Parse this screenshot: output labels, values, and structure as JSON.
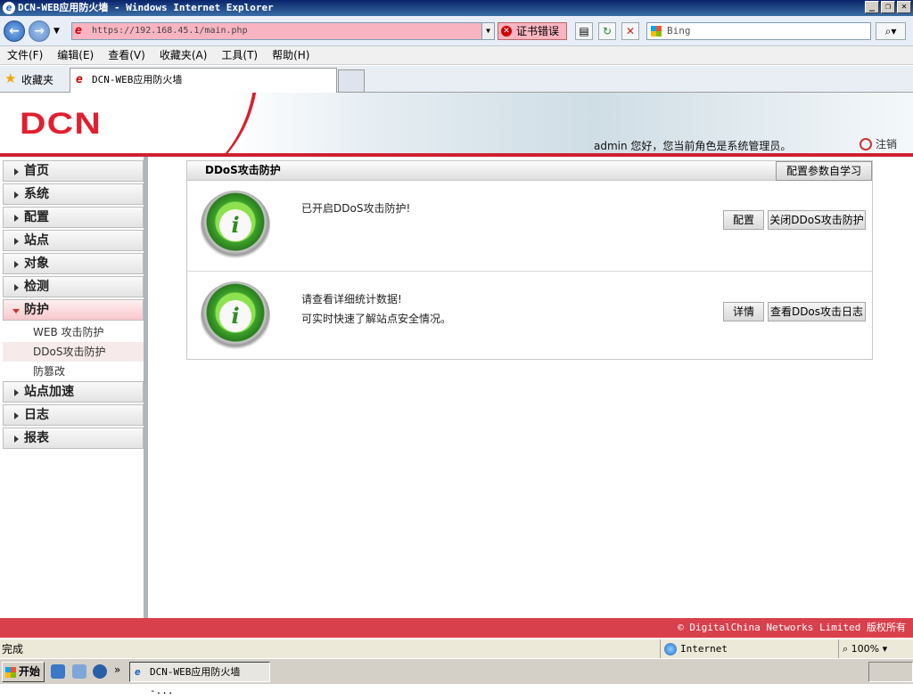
{
  "window": {
    "title": "DCN-WEB应用防火墙 - Windows Internet Explorer"
  },
  "browser": {
    "url": "https://192.168.45.1/main.php",
    "cert_error": "证书错误",
    "search_placeholder": "Bing",
    "menu": [
      "文件(F)",
      "编辑(E)",
      "查看(V)",
      "收藏夹(A)",
      "工具(T)",
      "帮助(H)"
    ],
    "favorites_label": "收藏夹",
    "tab_title": "DCN-WEB应用防火墙",
    "status_text": "完成",
    "zone": "Internet",
    "zoom": "100%"
  },
  "header": {
    "logo": "DCN",
    "welcome": "admin 您好，您当前角色是系统管理员。",
    "logout": "注销"
  },
  "sidebar": {
    "items": [
      "首页",
      "系统",
      "配置",
      "站点",
      "对象",
      "检测",
      "防护"
    ],
    "sub_items": [
      "WEB 攻击防护",
      "DDoS攻击防护",
      "防篡改"
    ],
    "items_after": [
      "站点加速",
      "日志",
      "报表"
    ]
  },
  "panel": {
    "title": "DDoS攻击防护",
    "header_button": "配置参数自学习",
    "rows": [
      {
        "lines": [
          "已开启DDoS攻击防护!"
        ],
        "buttons": [
          "配置",
          "关闭DDoS攻击防护"
        ]
      },
      {
        "lines": [
          "请查看详细统计数据!",
          "可实时快速了解站点安全情况。"
        ],
        "buttons": [
          "详情",
          "查看DDos攻击日志"
        ]
      }
    ]
  },
  "footer": {
    "copyright": "© DigitalChina Networks Limited 版权所有"
  },
  "taskbar": {
    "start": "开始",
    "task": "DCN-WEB应用防火墙 -..."
  }
}
